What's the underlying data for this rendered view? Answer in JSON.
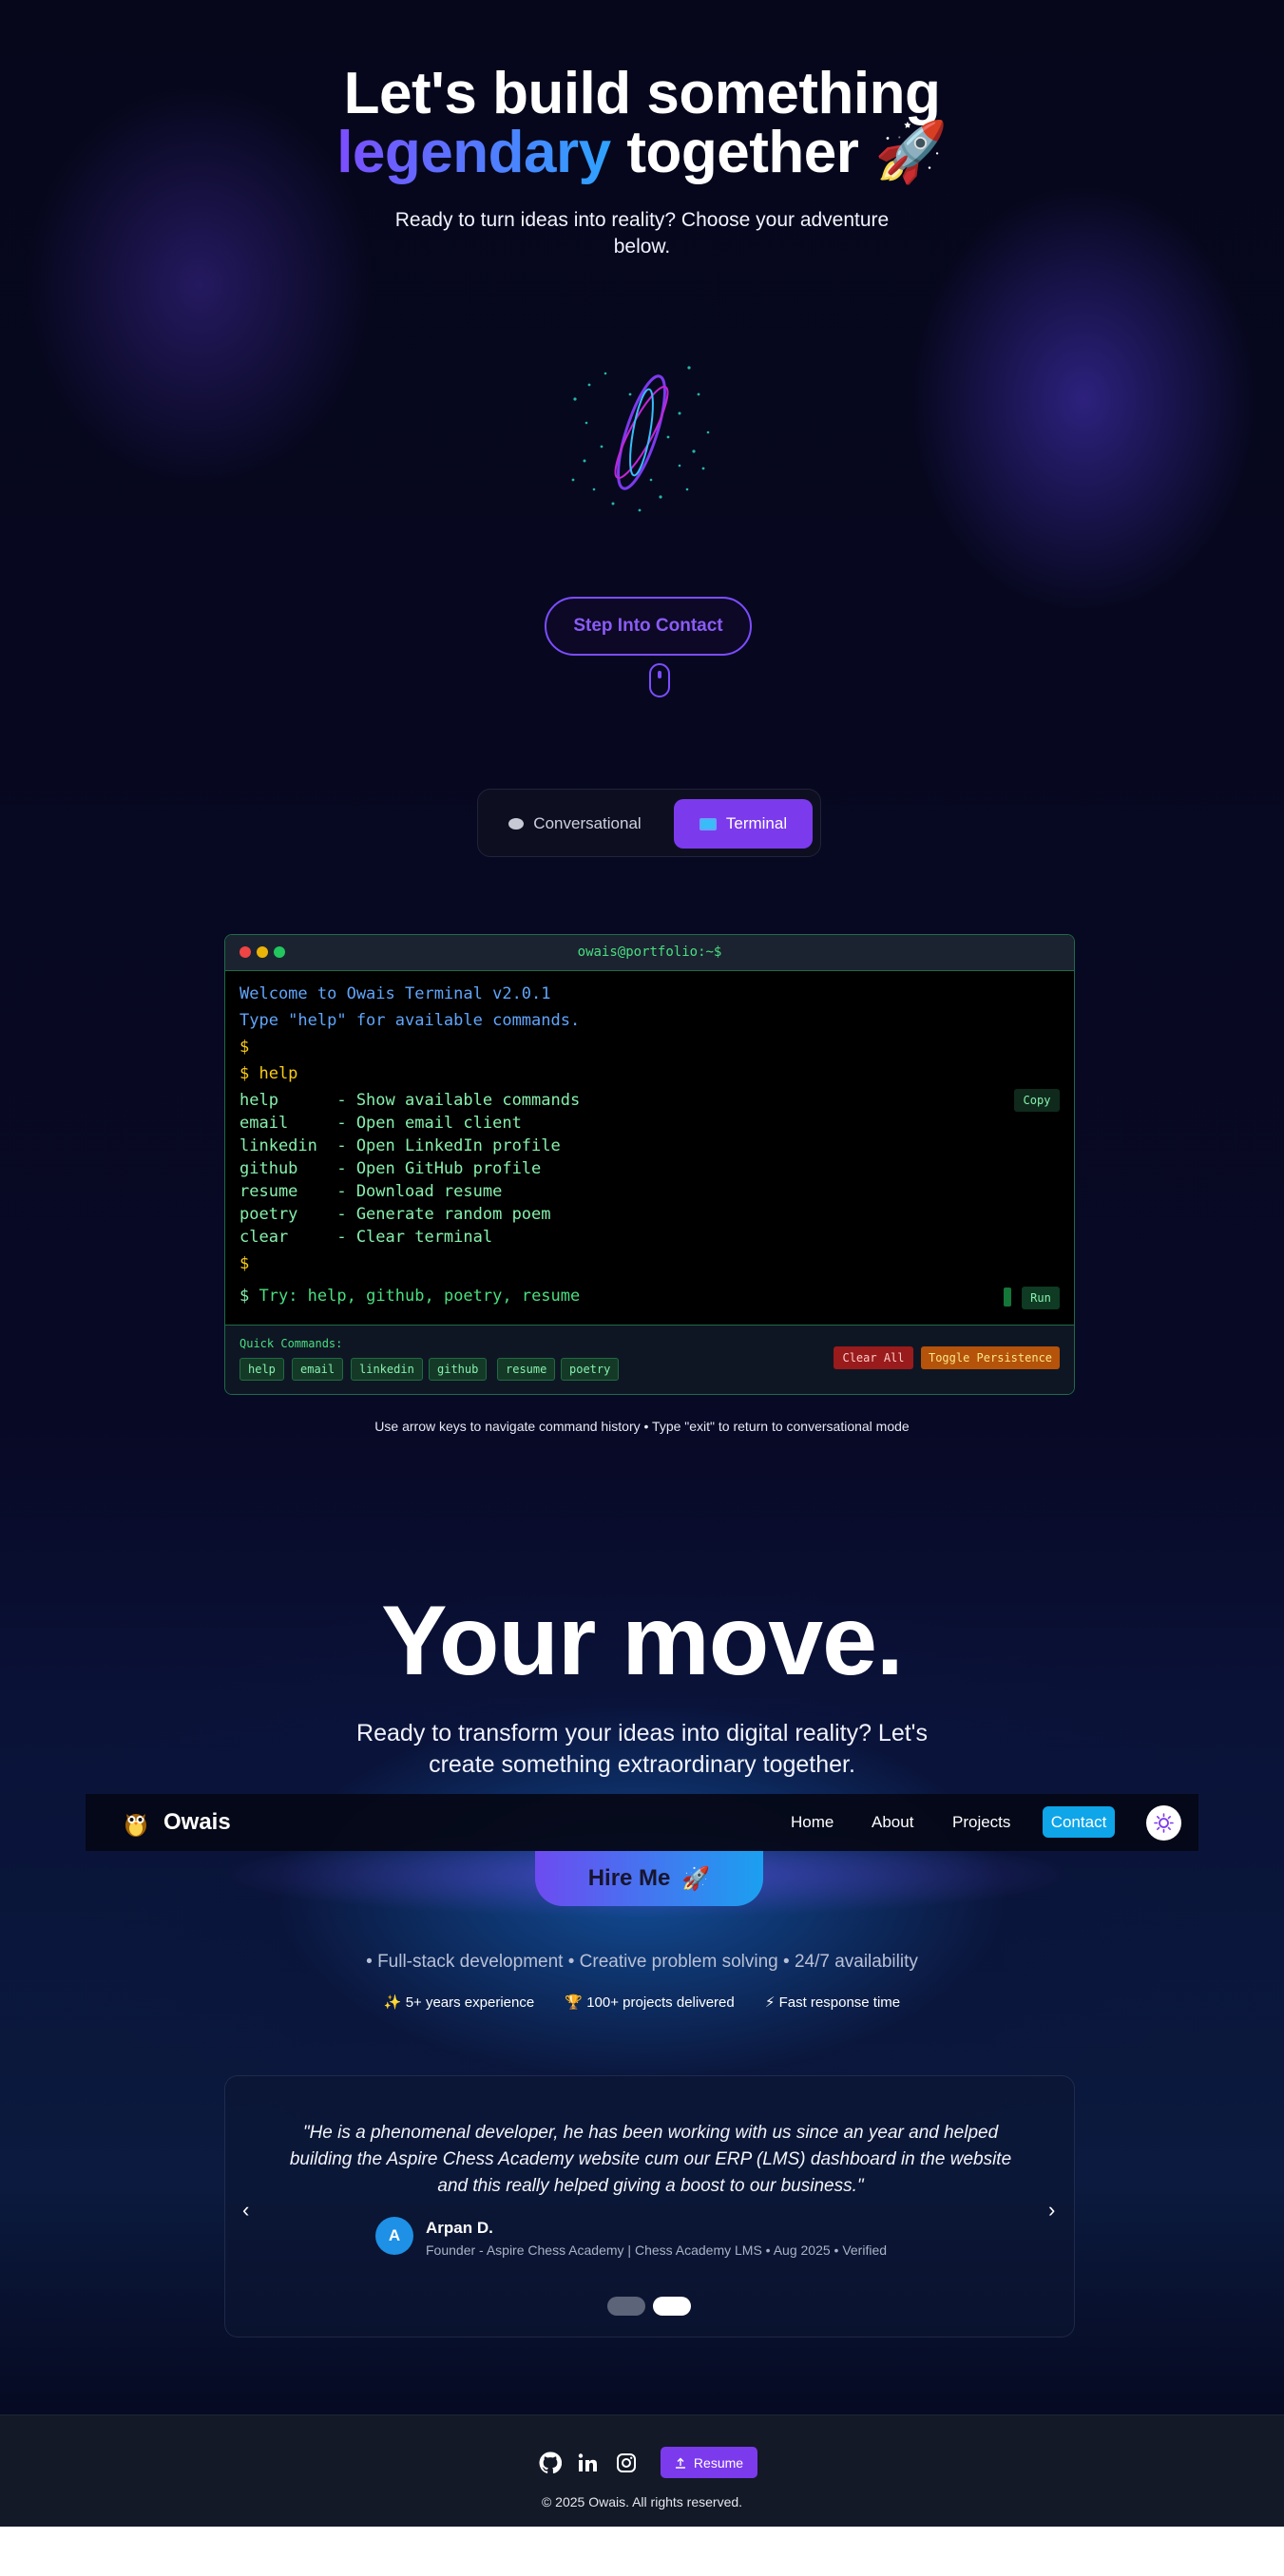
{
  "hero": {
    "title_line1": "Let's build something",
    "title_highlight": "legendary",
    "title_rest": "together",
    "title_emoji": "🚀",
    "subtitle": "Ready to turn ideas into reality? Choose your adventure below.",
    "cta_label": "Step Into Contact"
  },
  "mode_toggle": {
    "conversational_label": "Conversational",
    "terminal_label": "Terminal",
    "active": "Terminal"
  },
  "terminal": {
    "title": "owais@portfolio:~$",
    "lines": [
      "Welcome to Owais Terminal v2.0.1",
      "Type \"help\" for available commands.",
      "$",
      "$ help",
      "help      - Show available commands",
      "email     - Open email client",
      "linkedin  - Open LinkedIn profile",
      "github    - Open GitHub profile",
      "resume    - Download resume",
      "poetry    - Generate random poem",
      "clear     - Clear terminal",
      "$"
    ],
    "prompt_symbol": "$",
    "input_placeholder": "Try: help, github, poetry, resume",
    "copy_label": "Copy",
    "run_label": "Run",
    "quick_label": "Quick Commands:",
    "quick_commands": [
      "help",
      "email",
      "linkedin",
      "github",
      "resume",
      "poetry"
    ],
    "clear_label": "Clear All",
    "persist_label": "Toggle Persistence",
    "hint": "Use arrow keys to navigate command history • Type \"exit\" to return to conversational mode"
  },
  "cta": {
    "title": "Your move.",
    "subtitle": "Ready to transform your ideas into digital reality? Let's create something extraordinary together.",
    "hire_label": "Hire Me",
    "hire_emoji": "🚀",
    "features": "• Full-stack development • Creative problem solving • 24/7 availability",
    "badges": [
      "✨ 5+ years experience",
      "🏆 100+ projects delivered",
      "⚡ Fast response time"
    ]
  },
  "nav": {
    "brand": "Owais",
    "links": [
      "Home",
      "About",
      "Projects"
    ],
    "contact_label": "Contact"
  },
  "testimonial": {
    "quote": "\"He is a phenomenal developer, he has been working with us since an year and helped building the Aspire Chess Academy website cum our ERP (LMS) dashboard in the website and this really helped giving a boost to our business.\"",
    "author_initial": "A",
    "author_name": "Arpan D.",
    "author_role": "Founder - Aspire Chess Academy | Chess Academy LMS • Aug 2025 • Verified",
    "prev": "‹",
    "next": "›",
    "active_index": 1
  },
  "footer": {
    "resume_label": "Resume",
    "copyright": "© 2025 Owais. All rights reserved."
  },
  "colors": {
    "accent_purple": "#7c3aed",
    "accent_blue": "#0ea5e9",
    "terminal_green": "#86efac",
    "background": "#05061a"
  }
}
